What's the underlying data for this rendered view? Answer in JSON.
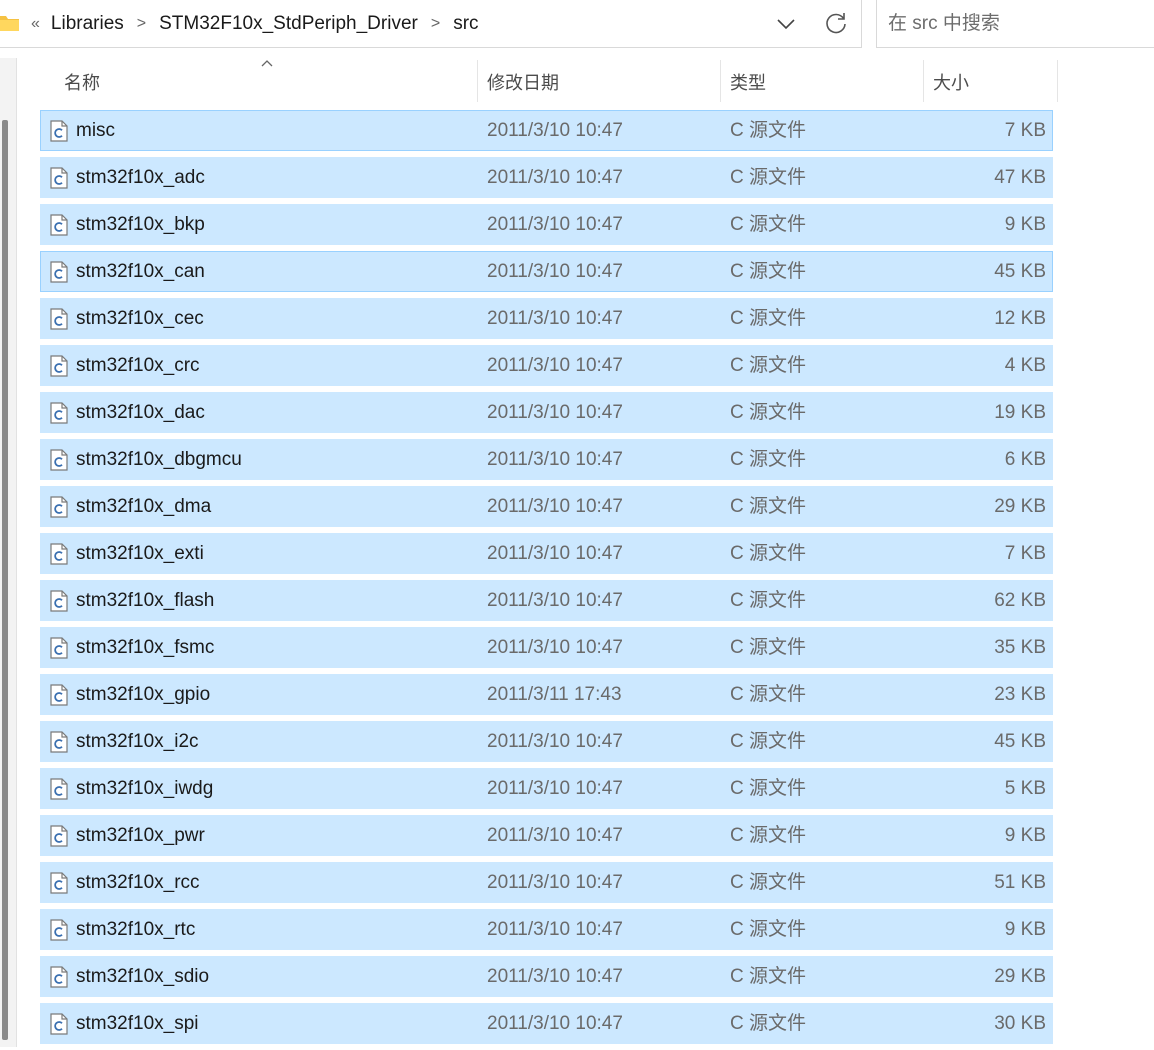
{
  "address_bar": {
    "overflow_label": "«",
    "crumbs": [
      "Libraries",
      "STM32F10x_StdPeriph_Driver",
      "src"
    ],
    "separator": ">"
  },
  "search": {
    "placeholder": "在 src 中搜索"
  },
  "columns": {
    "name": "名称",
    "date": "修改日期",
    "type": "类型",
    "size": "大小"
  },
  "sort": {
    "column": "name",
    "direction": "ascending"
  },
  "files": [
    {
      "name": "misc",
      "date": "2011/3/10 10:47",
      "type": "C 源文件",
      "size": "7 KB"
    },
    {
      "name": "stm32f10x_adc",
      "date": "2011/3/10 10:47",
      "type": "C 源文件",
      "size": "47 KB"
    },
    {
      "name": "stm32f10x_bkp",
      "date": "2011/3/10 10:47",
      "type": "C 源文件",
      "size": "9 KB"
    },
    {
      "name": "stm32f10x_can",
      "date": "2011/3/10 10:47",
      "type": "C 源文件",
      "size": "45 KB"
    },
    {
      "name": "stm32f10x_cec",
      "date": "2011/3/10 10:47",
      "type": "C 源文件",
      "size": "12 KB"
    },
    {
      "name": "stm32f10x_crc",
      "date": "2011/3/10 10:47",
      "type": "C 源文件",
      "size": "4 KB"
    },
    {
      "name": "stm32f10x_dac",
      "date": "2011/3/10 10:47",
      "type": "C 源文件",
      "size": "19 KB"
    },
    {
      "name": "stm32f10x_dbgmcu",
      "date": "2011/3/10 10:47",
      "type": "C 源文件",
      "size": "6 KB"
    },
    {
      "name": "stm32f10x_dma",
      "date": "2011/3/10 10:47",
      "type": "C 源文件",
      "size": "29 KB"
    },
    {
      "name": "stm32f10x_exti",
      "date": "2011/3/10 10:47",
      "type": "C 源文件",
      "size": "7 KB"
    },
    {
      "name": "stm32f10x_flash",
      "date": "2011/3/10 10:47",
      "type": "C 源文件",
      "size": "62 KB"
    },
    {
      "name": "stm32f10x_fsmc",
      "date": "2011/3/10 10:47",
      "type": "C 源文件",
      "size": "35 KB"
    },
    {
      "name": "stm32f10x_gpio",
      "date": "2011/3/11 17:43",
      "type": "C 源文件",
      "size": "23 KB"
    },
    {
      "name": "stm32f10x_i2c",
      "date": "2011/3/10 10:47",
      "type": "C 源文件",
      "size": "45 KB"
    },
    {
      "name": "stm32f10x_iwdg",
      "date": "2011/3/10 10:47",
      "type": "C 源文件",
      "size": "5 KB"
    },
    {
      "name": "stm32f10x_pwr",
      "date": "2011/3/10 10:47",
      "type": "C 源文件",
      "size": "9 KB"
    },
    {
      "name": "stm32f10x_rcc",
      "date": "2011/3/10 10:47",
      "type": "C 源文件",
      "size": "51 KB"
    },
    {
      "name": "stm32f10x_rtc",
      "date": "2011/3/10 10:47",
      "type": "C 源文件",
      "size": "9 KB"
    },
    {
      "name": "stm32f10x_sdio",
      "date": "2011/3/10 10:47",
      "type": "C 源文件",
      "size": "29 KB"
    },
    {
      "name": "stm32f10x_spi",
      "date": "2011/3/10 10:47",
      "type": "C 源文件",
      "size": "30 KB"
    }
  ],
  "colors": {
    "selection": "#cce8ff",
    "selection_focus_border": "#99d1ff",
    "folder": "#f5c243"
  },
  "icons": {
    "file": "c-source-file-icon",
    "folder": "folder-icon",
    "dropdown": "chevron-down-icon",
    "refresh": "refresh-icon"
  }
}
